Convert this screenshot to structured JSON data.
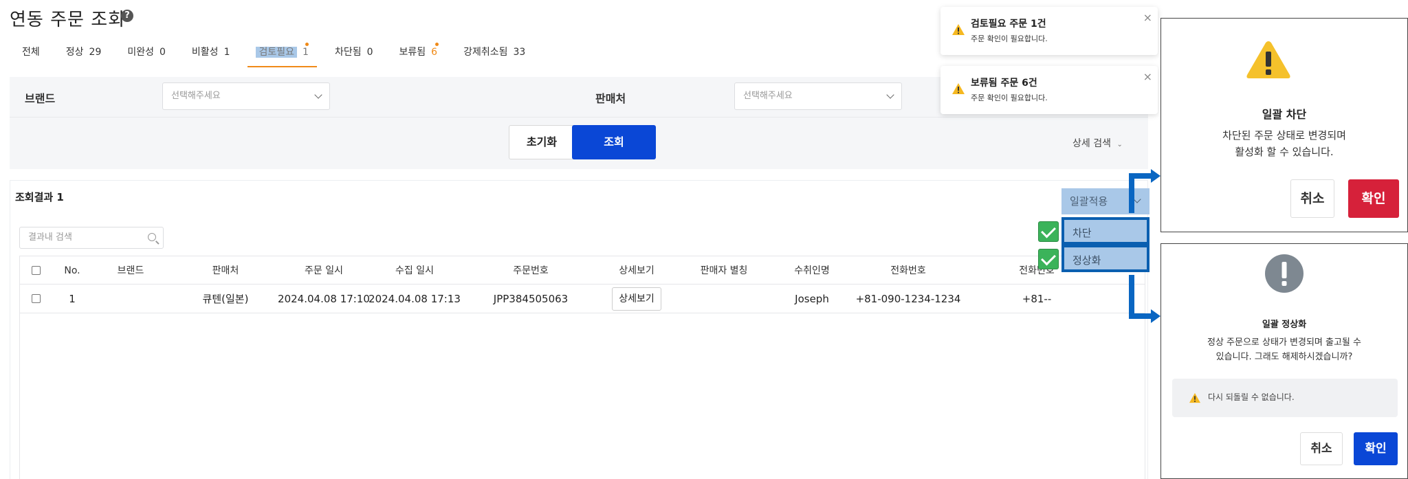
{
  "page": {
    "title": "연동 주문 조회",
    "help_icon": "question-circle-icon"
  },
  "tabs": [
    {
      "label": "전체",
      "count": ""
    },
    {
      "label": "정상",
      "count": "29"
    },
    {
      "label": "미완성",
      "count": "0"
    },
    {
      "label": "비활성",
      "count": "1"
    },
    {
      "label": "검토필요",
      "count": "1"
    },
    {
      "label": "차단됨",
      "count": "0"
    },
    {
      "label": "보류됨",
      "count": "6"
    },
    {
      "label": "강제취소됨",
      "count": "33"
    }
  ],
  "filters": {
    "brand_label": "브랜드",
    "brand_placeholder": "선택해주세요",
    "seller_label": "판매처",
    "seller_placeholder": "선택해주세요",
    "reset_label": "초기화",
    "search_label": "조회",
    "advanced_label": "상세 검색"
  },
  "results": {
    "title": "조회결과 1",
    "search_placeholder": "결과내 검색",
    "columns": [
      "No.",
      "브랜드",
      "판매처",
      "주문 일시",
      "수집 일시",
      "주문번호",
      "상세보기",
      "판매자 별칭",
      "수취인명",
      "전화번호",
      "전화번호"
    ],
    "rows": [
      {
        "no": "1",
        "brand": "",
        "seller": "큐텐(일본)",
        "order_time": "2024.04.08 17:10",
        "collect_time": "2024.04.08 17:13",
        "order_no": "JPP384505063",
        "detail_label": "상세보기",
        "seller_alias": "",
        "recipient": "Joseph",
        "phone": "+81-090-1234-1234",
        "phone2": "+81--"
      }
    ]
  },
  "bulk_apply": {
    "label": "일괄적용",
    "options": [
      "차단",
      "정상화"
    ]
  },
  "toasts": [
    {
      "title": "검토필요 주문 1건",
      "message": "주문 확인이 필요합니다."
    },
    {
      "title": "보류됨 주문 6건",
      "message": "주문 확인이 필요합니다."
    }
  ],
  "modal_block": {
    "title": "일괄 차단",
    "line1": "차단된 주문 상태로 변경되며",
    "line2": "활성화 할 수 있습니다.",
    "cancel_label": "취소",
    "confirm_label": "확인",
    "confirm_color": "#d6213a"
  },
  "modal_normalize": {
    "title": "일괄 정상화",
    "line1": "정상 주문으로 상태가 변경되며 출고될 수",
    "line2": "있습니다. 그래도 해제하시겠습니까?",
    "warning": "다시 되돌릴 수 없습니다.",
    "cancel_label": "취소",
    "confirm_label": "확인",
    "confirm_color": "#0a47d6"
  },
  "colors": {
    "primary": "#0a47d6",
    "accent_orange": "#f08a18",
    "highlight_blue": "#a9c8e8",
    "danger": "#d6213a",
    "warning_yellow": "#f5b820"
  }
}
